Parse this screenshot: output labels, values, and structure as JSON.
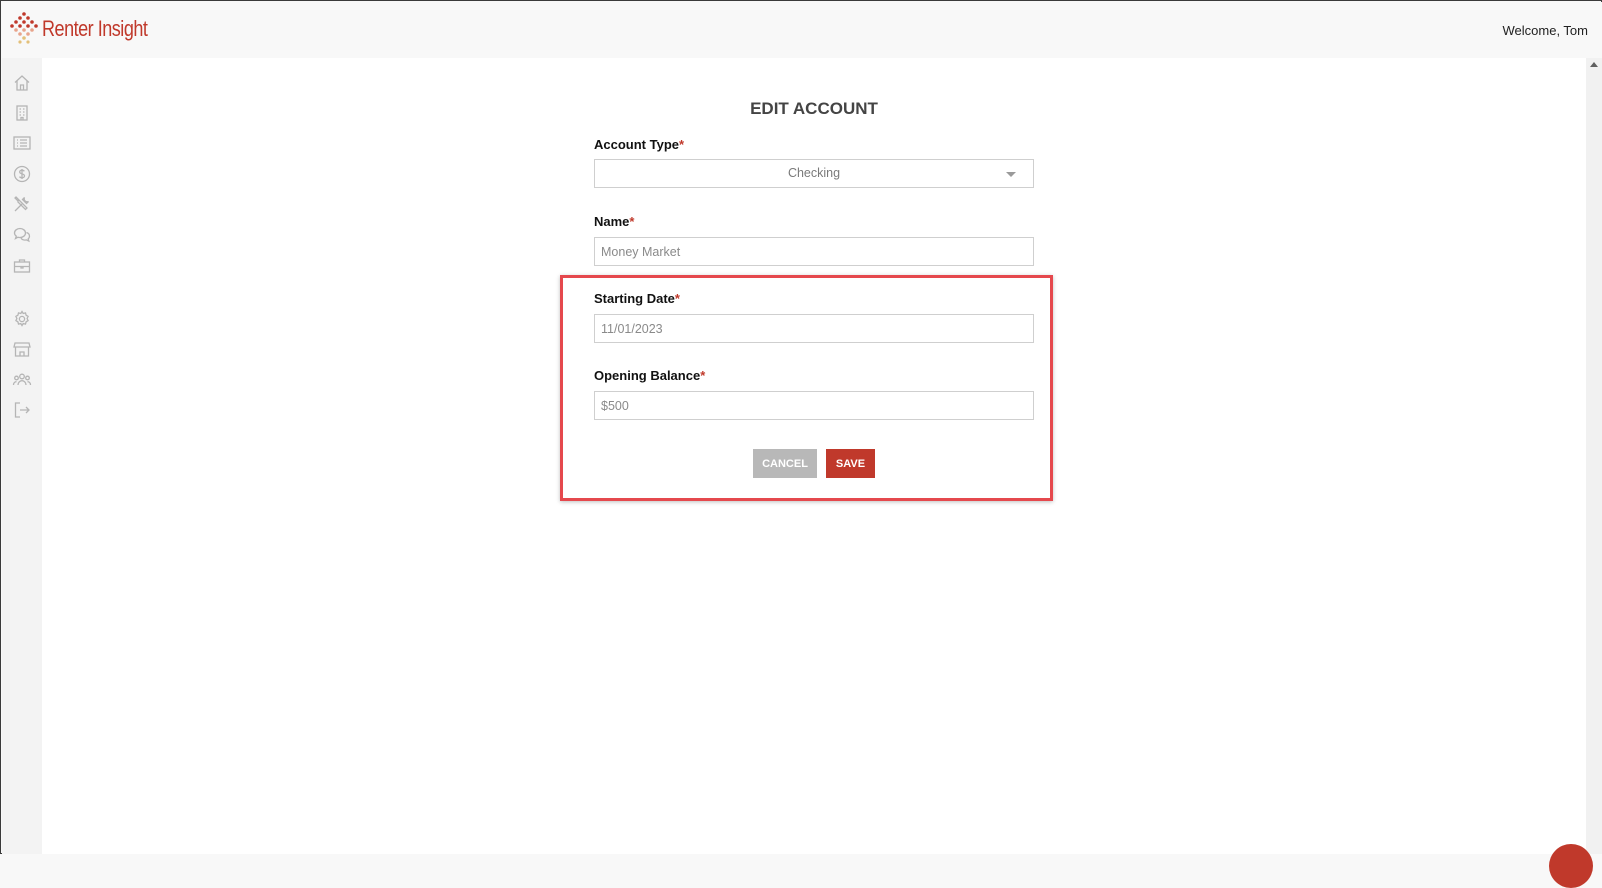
{
  "header": {
    "brand": "Renter Insight",
    "welcome": "Welcome, Tom"
  },
  "sidebar": {
    "items": [
      {
        "icon": "home-icon"
      },
      {
        "icon": "building-icon"
      },
      {
        "icon": "list-icon"
      },
      {
        "icon": "dollar-icon"
      },
      {
        "icon": "tools-icon"
      },
      {
        "icon": "chat-icon"
      },
      {
        "icon": "briefcase-icon"
      },
      {
        "icon": "gear-icon"
      },
      {
        "icon": "store-icon"
      },
      {
        "icon": "users-icon"
      },
      {
        "icon": "logout-icon"
      }
    ]
  },
  "form": {
    "title": "EDIT ACCOUNT",
    "account_type": {
      "label": "Account Type",
      "value": "Checking"
    },
    "name": {
      "label": "Name",
      "value": "Money Market"
    },
    "starting_date": {
      "label": "Starting Date",
      "value": "11/01/2023"
    },
    "opening_balance": {
      "label": "Opening Balance",
      "value": "$500"
    },
    "required_mark": "*",
    "cancel_label": "CANCEL",
    "save_label": "SAVE"
  },
  "colors": {
    "brand": "#c0392b",
    "highlight": "#e5484d",
    "cancel_bg": "#b8b8b8"
  }
}
